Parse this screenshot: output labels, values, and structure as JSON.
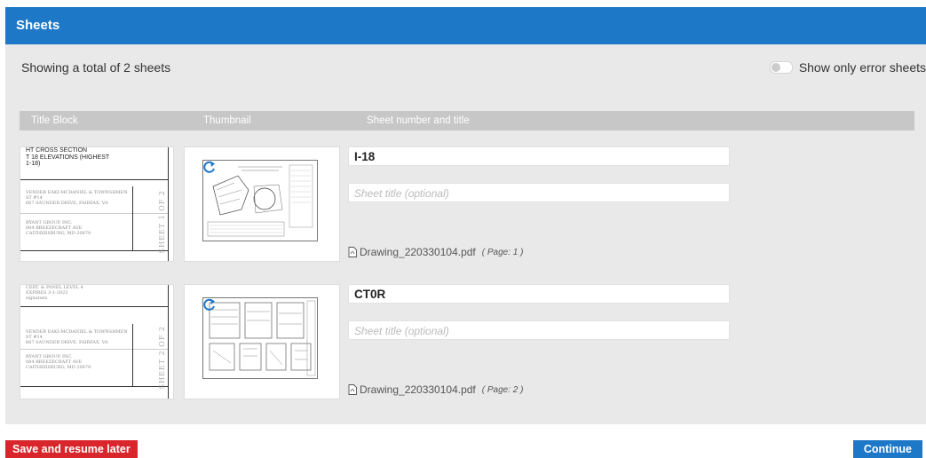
{
  "panel": {
    "title": "Sheets",
    "summary": "Showing a total of 2 sheets",
    "toggle_label": "Show only error sheets"
  },
  "columns": {
    "title_block": "Title Block",
    "thumbnail": "Thumbnail",
    "sheet": "Sheet number and title"
  },
  "sheets": [
    {
      "titleblock_lines": "HT CROSS SECTION\nT 18 ELEVATIONS (HIGHEST\n1-18)",
      "titleblock_owner": "VENDER EAKI-MCDANIEL & TOWNSHMEN\nST #14\n667 SAUNDER DRIVE, FAIRFAX, VA",
      "titleblock_firm": "RYANT GROUP, INC.\n084 BREEZECRAFT AVE\nCAITHERSBURG, MD 20879",
      "titleblock_side": "SHEET 1 OF 2",
      "number": "I-18",
      "title_placeholder": "Sheet title (optional)",
      "file": "Drawing_220330104.pdf",
      "page": "( Page: 1 )"
    },
    {
      "titleblock_lines": "CERT. & PANEL LEVEL 4\nEXPIRES 3-1-2023\nsignature",
      "titleblock_owner": "VENDER EAKI-MCDANIEL & TOWNSHMEN\nST #14\n667 SAUNDER DRIVE, FAIRFAX, VA",
      "titleblock_firm": "RYANT GROUP, INC.\n084 BREEZECRAFT AVE\nCAITHERSBURG, MD 20879",
      "titleblock_side": "SHEET 2 OF 2",
      "number": "CT0R",
      "title_placeholder": "Sheet title (optional)",
      "file": "Drawing_220330104.pdf",
      "page": "( Page: 2 )"
    }
  ],
  "buttons": {
    "save": "Save and resume later",
    "continue": "Continue"
  },
  "icons": {
    "rotate": "rotate-icon",
    "pdf": "pdf-file-icon"
  },
  "colors": {
    "header": "#1e78c8",
    "danger": "#d9262c",
    "primary": "#1e78c8"
  }
}
